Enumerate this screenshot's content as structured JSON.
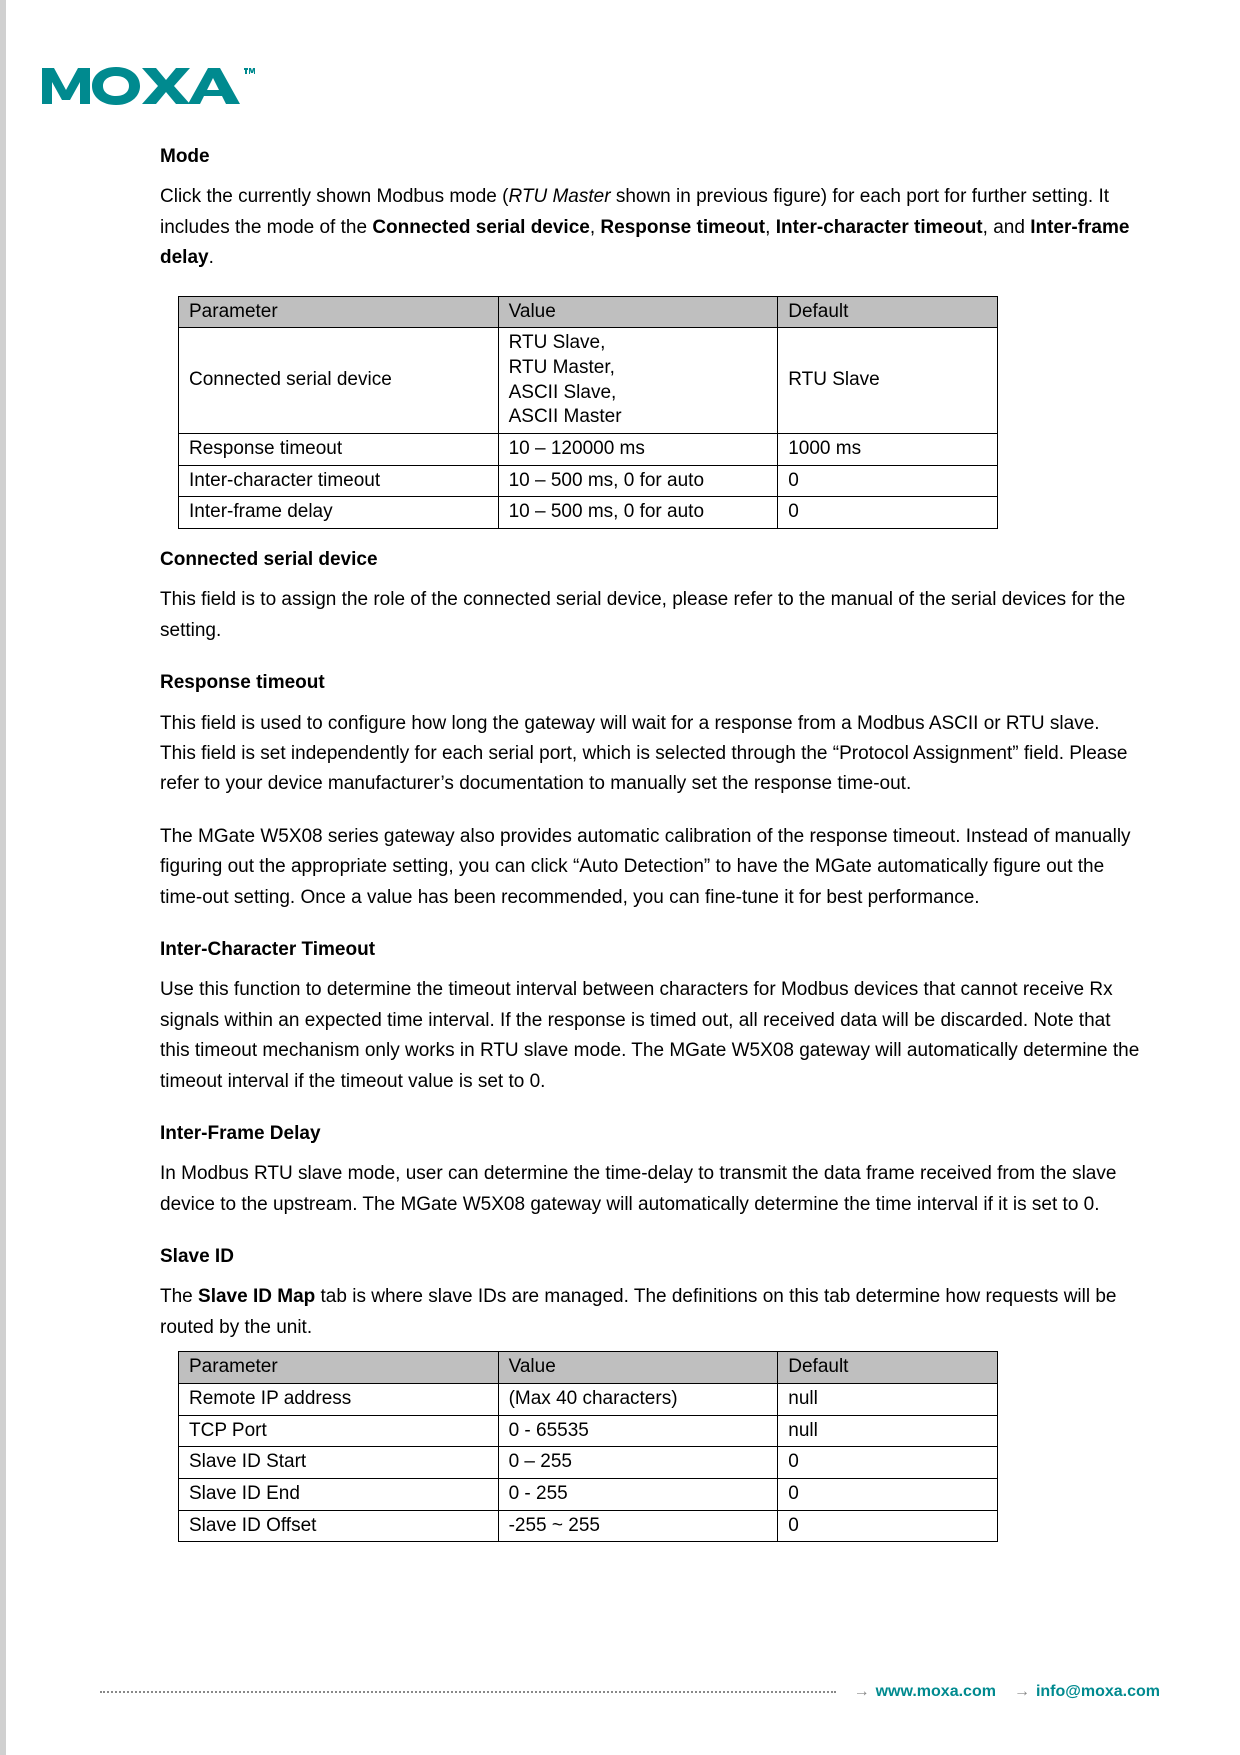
{
  "brand": {
    "name": "MOXA",
    "color": "#008a8f"
  },
  "sections": {
    "mode": {
      "heading": "Mode",
      "para_parts": {
        "p1": "Click the currently shown Modbus mode (",
        "p2": "RTU Master",
        "p3": " shown in previous figure) for each port for further setting. It includes the mode of the ",
        "p4": "Connected serial device",
        "p5": ", ",
        "p6": "Response timeout",
        "p7": ", ",
        "p8": "Inter-character timeout",
        "p9": ", and ",
        "p10": "Inter-frame delay",
        "p11": "."
      }
    },
    "table1": {
      "headers": {
        "parameter": "Parameter",
        "value": "Value",
        "default": "Default"
      },
      "rows": [
        {
          "parameter": "Connected serial device",
          "value": "RTU Slave,\nRTU Master,\nASCII Slave,\nASCII Master",
          "default": "RTU Slave"
        },
        {
          "parameter": "Response timeout",
          "value": "10 – 120000 ms",
          "default": "1000 ms"
        },
        {
          "parameter": "Inter-character timeout",
          "value": "10 – 500 ms, 0 for auto",
          "default": "0"
        },
        {
          "parameter": "Inter-frame delay",
          "value": "10 – 500 ms, 0 for auto",
          "default": "0"
        }
      ]
    },
    "csd": {
      "heading": "Connected serial device",
      "para": "This field is to assign the role of the connected serial device, please refer to the manual of the serial devices for the setting."
    },
    "rt": {
      "heading": "Response timeout",
      "para1": "This field is used to configure how long the gateway will wait for a response from a Modbus ASCII or RTU slave. This field is set independently for each serial port, which is selected through the “Protocol Assignment” field. Please refer to your device manufacturer’s documentation to manually set the response time-out.",
      "para2": "The MGate W5X08 series gateway also provides automatic calibration of the response timeout. Instead of manually figuring out the appropriate setting, you can click “Auto Detection” to have the MGate automatically figure out the time-out setting. Once a value has been recommended, you can fine-tune it for best performance."
    },
    "ict": {
      "heading": "Inter-Character Timeout",
      "para": "Use this function to determine the timeout interval between characters for Modbus devices that cannot receive Rx signals within an expected time interval. If the response is timed out, all received data will be discarded. Note that this timeout mechanism only works in RTU slave mode. The MGate W5X08 gateway will automatically determine the timeout interval if the timeout value is set to 0."
    },
    "ifd": {
      "heading": "Inter-Frame Delay",
      "para": "In Modbus RTU slave mode, user can determine the time-delay to transmit the data frame received from the slave device to the upstream. The MGate W5X08 gateway will automatically determine the time interval if it is set to 0."
    },
    "sid": {
      "heading": "Slave ID",
      "para_parts": {
        "p1": "The ",
        "p2": "Slave ID Map",
        "p3": " tab is where slave IDs are managed. The definitions on this tab determine how requests will be routed by the unit."
      }
    },
    "table2": {
      "headers": {
        "parameter": "Parameter",
        "value": "Value",
        "default": "Default"
      },
      "rows": [
        {
          "parameter": "Remote IP address",
          "value": "(Max 40 characters)",
          "default": "null"
        },
        {
          "parameter": "TCP Port",
          "value": "0 - 65535",
          "default": "null"
        },
        {
          "parameter": "Slave ID Start",
          "value": "0 – 255",
          "default": "0"
        },
        {
          "parameter": "Slave ID End",
          "value": "0 - 255",
          "default": "0"
        },
        {
          "parameter": "Slave ID Offset",
          "value": "-255 ~ 255",
          "default": "0"
        }
      ]
    }
  },
  "footer": {
    "url": "www.moxa.com",
    "email": "info@moxa.com"
  }
}
